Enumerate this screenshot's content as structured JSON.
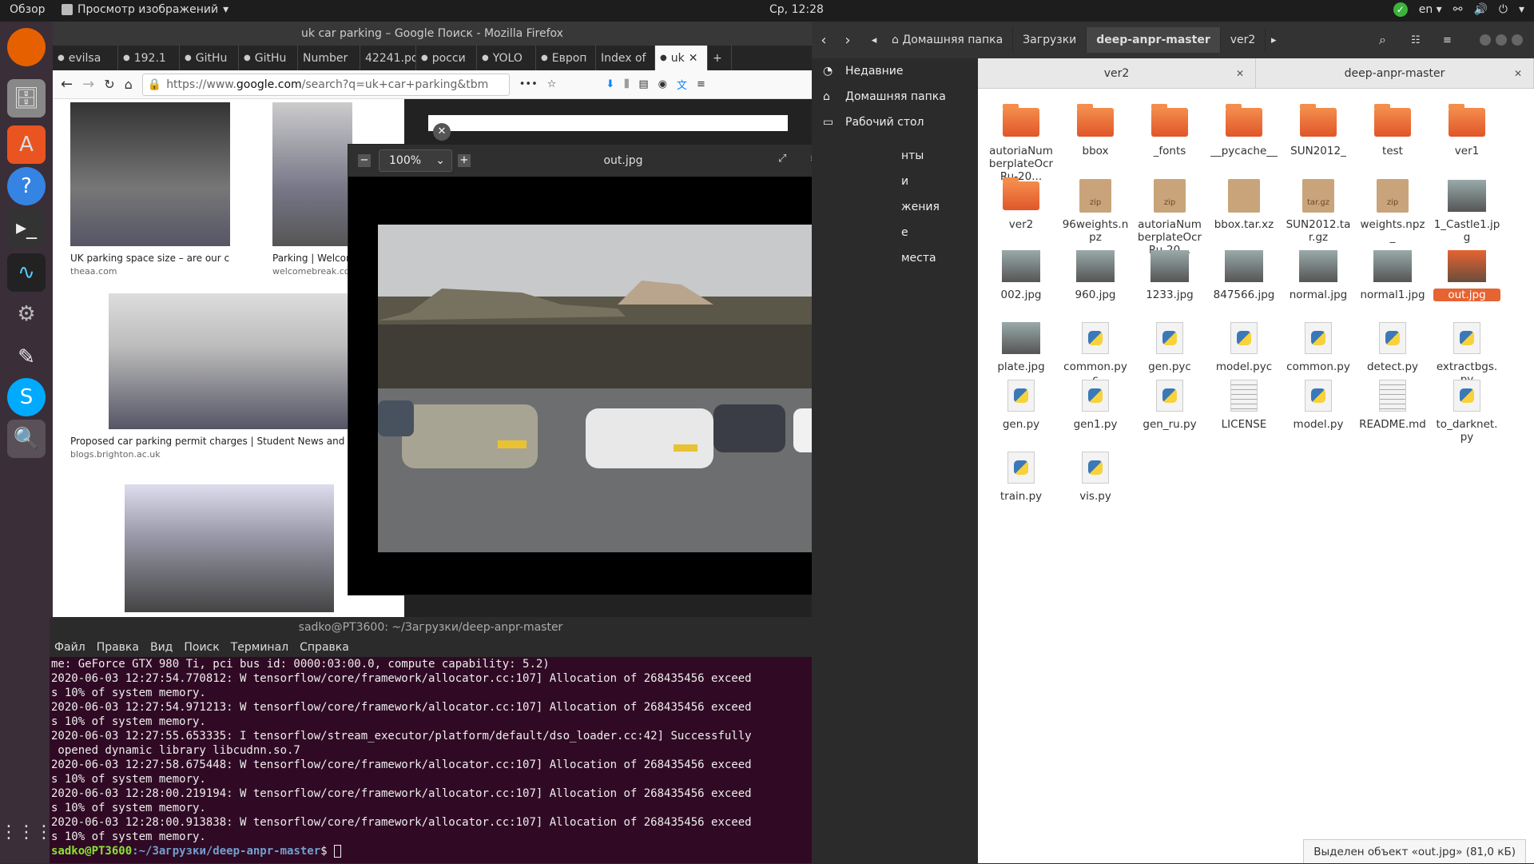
{
  "topbar": {
    "activities": "Обзор",
    "app_menu": "Просмотр изображений",
    "clock": "Ср, 12:28",
    "lang": "en"
  },
  "firefox": {
    "title": "uk car parking – Google Поиск - Mozilla Firefox",
    "tabs": [
      {
        "label": "evilsa",
        "icon": "github-icon"
      },
      {
        "label": "192.1",
        "icon": "warning-icon"
      },
      {
        "label": "GitHu",
        "icon": "github-icon"
      },
      {
        "label": "GitHu",
        "icon": "github-icon"
      },
      {
        "label": "Number",
        "icon": ""
      },
      {
        "label": "42241.pd",
        "icon": ""
      },
      {
        "label": "росси",
        "icon": "google-icon"
      },
      {
        "label": "YOLO",
        "icon": "yolo-icon"
      },
      {
        "label": "Европ",
        "icon": "wikipedia-icon"
      },
      {
        "label": "Index of",
        "icon": ""
      },
      {
        "label": "uk",
        "icon": "google-icon"
      }
    ],
    "url_prefix": "https://www.",
    "url_domain": "google.com",
    "url_rest": "/search?q=uk+car+parking&tbm",
    "results": [
      {
        "caption": "UK parking space size – are our cars g...",
        "source": "theaa.com"
      },
      {
        "caption": "Parking | Welcom",
        "source": "welcomebreak.co"
      },
      {
        "caption": "Proposed car parking permit charges | Student News and Even",
        "source": "blogs.brighton.ac.uk"
      },
      {
        "caption": "",
        "source": ""
      }
    ]
  },
  "viewer": {
    "zoom": "100%",
    "filename": "out.jpg"
  },
  "terminal": {
    "title": "sadko@PT3600: ~/Загрузки/deep-anpr-master",
    "menu": [
      "Файл",
      "Правка",
      "Вид",
      "Поиск",
      "Терминал",
      "Справка"
    ],
    "lines": [
      "me: GeForce GTX 980 Ti, pci bus id: 0000:03:00.0, compute capability: 5.2)",
      "2020-06-03 12:27:54.770812: W tensorflow/core/framework/allocator.cc:107] Allocation of 268435456 exceed",
      "s 10% of system memory.",
      "2020-06-03 12:27:54.971213: W tensorflow/core/framework/allocator.cc:107] Allocation of 268435456 exceed",
      "s 10% of system memory.",
      "2020-06-03 12:27:55.653335: I tensorflow/stream_executor/platform/default/dso_loader.cc:42] Successfully",
      " opened dynamic library libcudnn.so.7",
      "2020-06-03 12:27:58.675448: W tensorflow/core/framework/allocator.cc:107] Allocation of 268435456 exceed",
      "s 10% of system memory.",
      "2020-06-03 12:28:00.219194: W tensorflow/core/framework/allocator.cc:107] Allocation of 268435456 exceed",
      "s 10% of system memory.",
      "2020-06-03 12:28:00.913838: W tensorflow/core/framework/allocator.cc:107] Allocation of 268435456 exceed",
      "s 10% of system memory."
    ],
    "prompt_user": "sadko@PT3600",
    "prompt_path": ":~/Загрузки/deep-anpr-master",
    "prompt_end": "$ "
  },
  "nautilus": {
    "breadcrumbs": [
      "Домашняя папка",
      "Загрузки",
      "deep-anpr-master",
      "ver2"
    ],
    "sidebar": [
      "Недавние",
      "Домашняя папка",
      "Рабочий стол",
      "нты",
      "и",
      "жения",
      "е",
      "места"
    ],
    "pane_tabs": [
      "ver2",
      "deep-anpr-master"
    ],
    "files": [
      {
        "name": "autoriaNumberplateOcrRu-20...",
        "type": "folder"
      },
      {
        "name": "bbox",
        "type": "folder"
      },
      {
        "name": "_fonts",
        "type": "folder"
      },
      {
        "name": "__pycache__",
        "type": "folder"
      },
      {
        "name": "SUN2012_",
        "type": "folder"
      },
      {
        "name": "test",
        "type": "folder"
      },
      {
        "name": "ver1",
        "type": "folder"
      },
      {
        "name": "ver2",
        "type": "folder"
      },
      {
        "name": "96weights.npz",
        "type": "zip"
      },
      {
        "name": "autoriaNumberplateOcrRu-20...",
        "type": "zip"
      },
      {
        "name": "bbox.tar.xz",
        "type": "arch"
      },
      {
        "name": "SUN2012.tar.gz",
        "type": "tar.gz"
      },
      {
        "name": "weights.npz_",
        "type": "zip"
      },
      {
        "name": "1_Castle1.jpg",
        "type": "image"
      },
      {
        "name": "002.jpg",
        "type": "image"
      },
      {
        "name": "960.jpg",
        "type": "image"
      },
      {
        "name": "1233.jpg",
        "type": "image"
      },
      {
        "name": "847566.jpg",
        "type": "image"
      },
      {
        "name": "normal.jpg",
        "type": "image"
      },
      {
        "name": "normal1.jpg",
        "type": "image"
      },
      {
        "name": "out.jpg",
        "type": "image-sel"
      },
      {
        "name": "plate.jpg",
        "type": "image"
      },
      {
        "name": "common.pyc",
        "type": "py"
      },
      {
        "name": "gen.pyc",
        "type": "py"
      },
      {
        "name": "model.pyc",
        "type": "py"
      },
      {
        "name": "common.py",
        "type": "py"
      },
      {
        "name": "detect.py",
        "type": "py"
      },
      {
        "name": "extractbgs.py",
        "type": "py"
      },
      {
        "name": "gen.py",
        "type": "py"
      },
      {
        "name": "gen1.py",
        "type": "py"
      },
      {
        "name": "gen_ru.py",
        "type": "py"
      },
      {
        "name": "LICENSE",
        "type": "txt"
      },
      {
        "name": "model.py",
        "type": "py"
      },
      {
        "name": "README.md",
        "type": "txt"
      },
      {
        "name": "to_darknet.py",
        "type": "py"
      },
      {
        "name": "train.py",
        "type": "py"
      },
      {
        "name": "vis.py",
        "type": "py"
      }
    ],
    "status": "Выделен объект «out.jpg» (81,0 кБ)"
  }
}
